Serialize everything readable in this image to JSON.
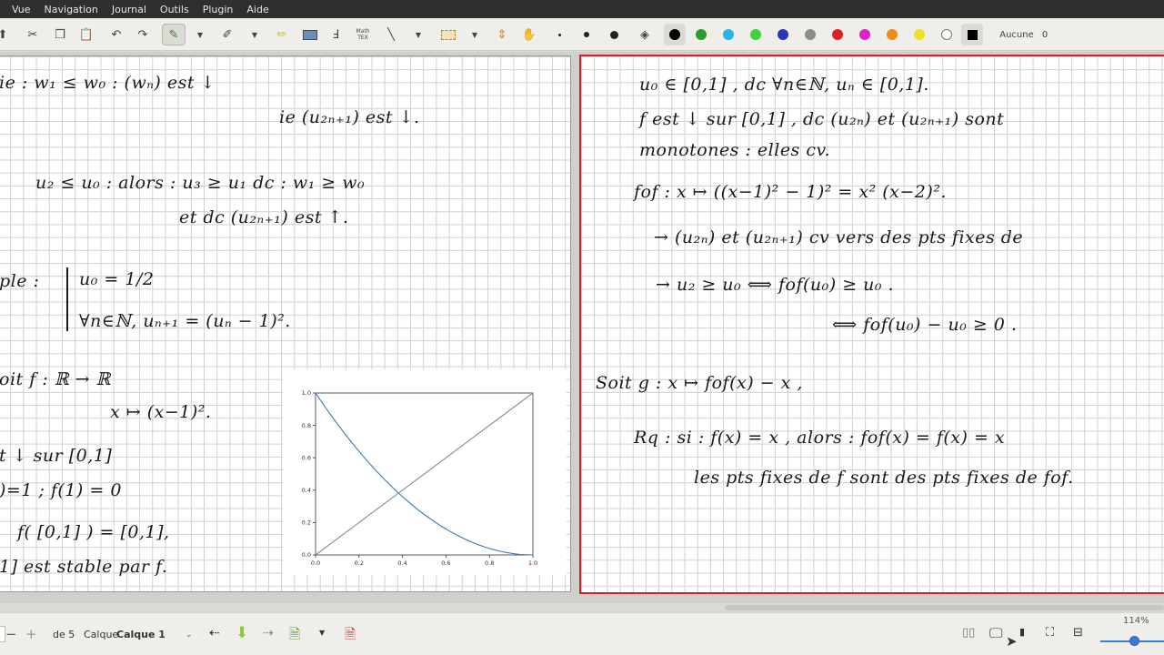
{
  "menu": [
    "Vue",
    "Navigation",
    "Journal",
    "Outils",
    "Plugin",
    "Aide"
  ],
  "toolbar": {
    "math_tex_label_1": "Math",
    "math_tex_label_2": "TEX",
    "selected_color": "#000000",
    "colors": [
      "#000000",
      "#2a9d2a",
      "#27b4e8",
      "#39d33a",
      "#2a36b5",
      "#8c8c8c",
      "#e02020",
      "#e020c8",
      "#f08a1a",
      "#f0e020",
      "#ffffff"
    ],
    "layer_label": "Aucune",
    "layer_count": "0"
  },
  "left_page": {
    "lines": [
      "ie :     w₁  ≤  w₀     :    (wₙ) est ↓",
      "ie (u₂ₙ₊₁) est ↓.",
      "u₂ ≤ u₀   :   alors :   u₃ ≥ u₁    dc :  w₁ ≥ w₀",
      "et   dc   (u₂ₙ₊₁)  est ↑.",
      "ple :",
      "u₀ = 1/2",
      "∀n∈ℕ,  uₙ₊₁ =  (uₙ − 1)².",
      "oit   f :  ℝ → ℝ",
      "x ↦ (x−1)².",
      "t ↓  sur [0,1]",
      ")=1 ;   f(1) = 0",
      "f( [0,1] ) = [0,1],",
      "1] est stable par f."
    ]
  },
  "chart_data": {
    "type": "line",
    "title": "",
    "xlabel": "",
    "ylabel": "",
    "xlim": [
      0.0,
      1.0
    ],
    "ylim": [
      0.0,
      1.0
    ],
    "x_ticks": [
      "0.0",
      "0.2",
      "0.4",
      "0.6",
      "0.8",
      "1.0"
    ],
    "y_ticks": [
      "0.0",
      "0.2",
      "0.4",
      "0.6",
      "0.8",
      "1.0"
    ],
    "series": [
      {
        "color": "#3b78b8",
        "x": [
          0,
          0.1,
          0.2,
          0.3,
          0.4,
          0.5,
          0.6,
          0.7,
          0.8,
          0.9,
          1.0
        ],
        "y": [
          1.0,
          0.81,
          0.64,
          0.49,
          0.36,
          0.25,
          0.16,
          0.09,
          0.04,
          0.01,
          0.0
        ]
      },
      {
        "color": "#8c8c8c",
        "x": [
          0,
          1.0
        ],
        "y": [
          0,
          1.0
        ]
      }
    ],
    "grid": false
  },
  "right_page": {
    "lines": [
      "u₀ ∈ [0,1] ,  dc ∀n∈ℕ,  uₙ ∈ [0,1].",
      "f est ↓ sur [0,1] ,  dc (u₂ₙ) et (u₂ₙ₊₁) sont",
      "monotones : elles cv.",
      "fof :   x ↦  ((x−1)² − 1)²  =   x²  (x−2)².",
      "→ (u₂ₙ) et (u₂ₙ₊₁)     cv vers des pts fixes de",
      "→   u₂ ≥ u₀     ⟺   fof(u₀) ≥ u₀ .",
      "⟺   fof(u₀) − u₀ ≥ 0 .",
      "Soit  g :   x ↦  fof(x) − x ,",
      "Rq :   si :    f(x) = x  , alors :  fof(x) = f(x) = x",
      "les pts fixes de f sont des pts fixes de fof."
    ]
  },
  "status": {
    "page_of": "de 5",
    "layer_prefix": "Calque",
    "layer_value": "Calque 1",
    "zoom": "114%"
  }
}
